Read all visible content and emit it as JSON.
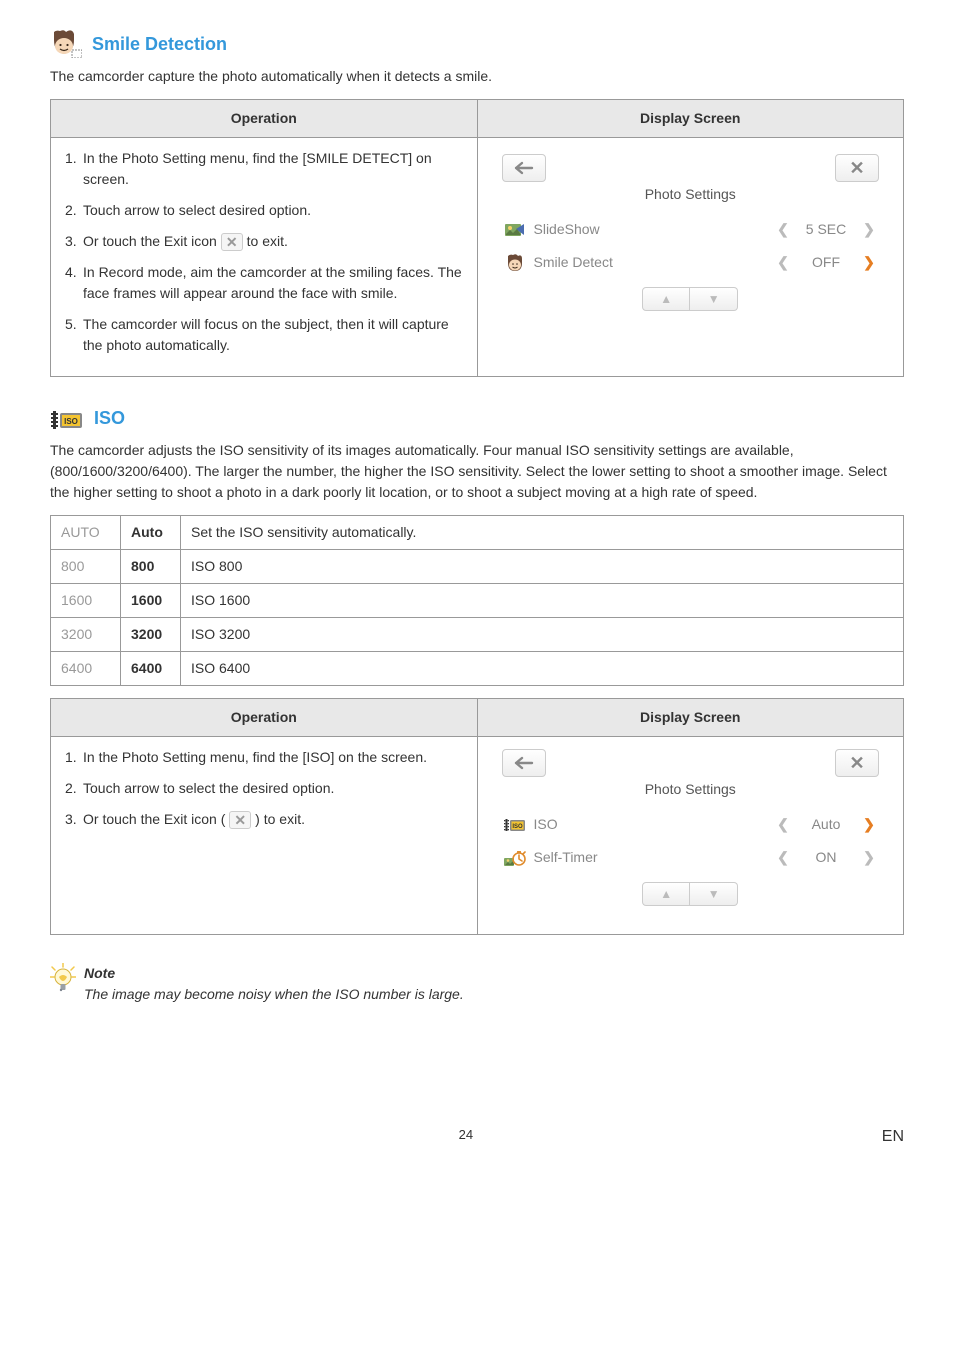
{
  "smile": {
    "heading": "Smile Detection",
    "intro": "The camcorder capture the photo automatically when it detects a smile.",
    "op_header": "Operation",
    "ds_header": "Display Screen",
    "steps": {
      "s1n": "1.",
      "s1": "In the Photo Setting menu, find the [SMILE DETECT] on screen.",
      "s2n": "2.",
      "s2": "Touch arrow to select desired option.",
      "s3n": "3.",
      "s3a": "Or touch the Exit icon ",
      "s3b": " to exit.",
      "s4n": "4.",
      "s4": "In Record mode, aim the camcorder at the smiling faces. The face frames will appear around the face with smile.",
      "s5n": "5.",
      "s5": "The camcorder will focus on the subject, then it will capture the photo automatically."
    },
    "screen": {
      "title": "Photo Settings",
      "r1": {
        "label": "SlideShow",
        "val": "5 SEC"
      },
      "r2": {
        "label": "Smile Detect",
        "val": "OFF"
      }
    }
  },
  "iso": {
    "heading": "ISO",
    "intro": "The camcorder adjusts the ISO sensitivity of its images automatically. Four manual ISO sensitivity settings are available, (800/1600/3200/6400). The larger the number, the higher the ISO sensitivity. Select the lower setting to shoot a smoother image. Select the higher setting to shoot a photo in a dark poorly lit location, or to shoot a subject moving at a high rate of speed.",
    "rows": [
      {
        "g": "AUTO",
        "b": "Auto",
        "d": "Set the ISO sensitivity automatically."
      },
      {
        "g": "800",
        "b": "800",
        "d": "ISO 800"
      },
      {
        "g": "1600",
        "b": "1600",
        "d": "ISO 1600"
      },
      {
        "g": "3200",
        "b": "3200",
        "d": "ISO 3200"
      },
      {
        "g": "6400",
        "b": "6400",
        "d": "ISO 6400"
      }
    ],
    "op_header": "Operation",
    "ds_header": "Display Screen",
    "steps": {
      "s1n": "1.",
      "s1": "In the Photo Setting menu, find the [ISO] on the screen.",
      "s2n": "2.",
      "s2": "Touch arrow to select the desired option.",
      "s3n": "3.",
      "s3a": "Or touch the Exit icon ( ",
      "s3b": " ) to exit."
    },
    "screen": {
      "title": "Photo Settings",
      "r1": {
        "label": "ISO",
        "val": "Auto"
      },
      "r2": {
        "label": "Self-Timer",
        "val": "ON"
      }
    }
  },
  "note": {
    "title": "Note",
    "body": "The image may become noisy when the ISO number is large."
  },
  "footer": {
    "page": "24",
    "en": "EN"
  }
}
